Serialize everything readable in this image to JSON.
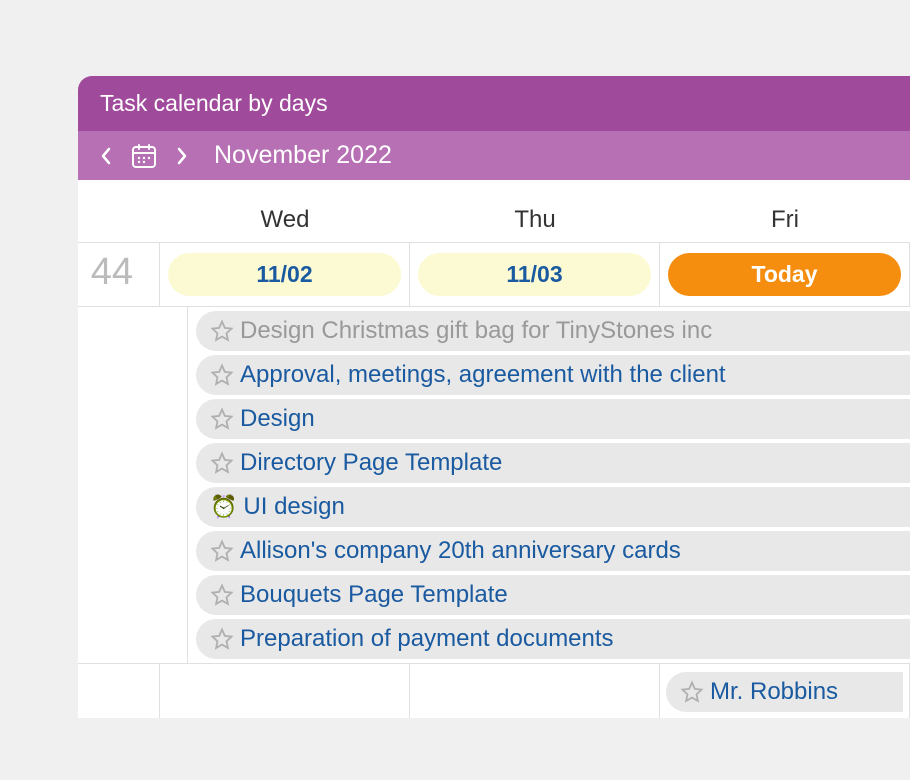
{
  "header": {
    "title": "Task calendar by days",
    "month_label": "November 2022"
  },
  "days": {
    "headers": [
      "Wed",
      "Thu",
      "Fri"
    ],
    "dates": [
      "11/02",
      "11/03"
    ],
    "today_label": "Today"
  },
  "week_number": "44",
  "tasks": [
    {
      "label": "Design Christmas gift bag for TinyStones inc",
      "muted": true,
      "icon": "star"
    },
    {
      "label": "Approval, meetings, agreement with the client",
      "muted": false,
      "icon": "star"
    },
    {
      "label": "Design",
      "muted": false,
      "icon": "star"
    },
    {
      "label": "Directory Page Template",
      "muted": false,
      "icon": "star"
    },
    {
      "label": "UI design",
      "muted": false,
      "icon": "clock"
    },
    {
      "label": "Allison's company 20th anniversary cards",
      "muted": false,
      "icon": "star"
    },
    {
      "label": "Bouquets Page Template",
      "muted": false,
      "icon": "star"
    },
    {
      "label": "Preparation of payment documents",
      "muted": false,
      "icon": "star"
    }
  ],
  "bottom_task": {
    "label": "Mr. Robbins"
  }
}
